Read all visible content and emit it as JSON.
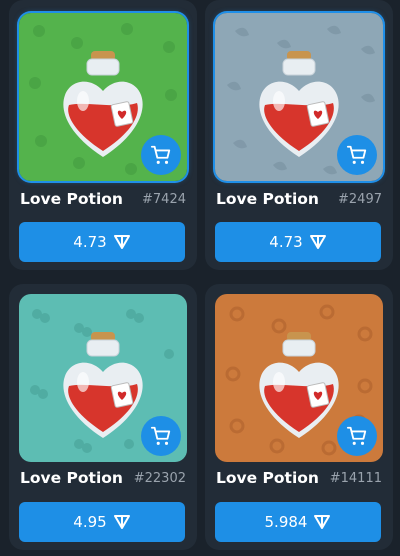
{
  "items": [
    {
      "name": "Love Potion",
      "number": "#7424",
      "price": "4.73",
      "bg": "#54b34c",
      "pattern": "#4aa345",
      "selected": true
    },
    {
      "name": "Love Potion",
      "number": "#2497",
      "price": "4.73",
      "bg": "#8ea7b6",
      "pattern": "#7f98a7",
      "selected": true
    },
    {
      "name": "Love Potion",
      "number": "#22302",
      "price": "4.95",
      "bg": "#5dbdb3",
      "pattern": "#4faaa0",
      "selected": false
    },
    {
      "name": "Love Potion",
      "number": "#14111",
      "price": "5.984",
      "bg": "#cc7a3c",
      "pattern": "#b96a32",
      "selected": false
    }
  ],
  "icons": {
    "cart": "cart-icon",
    "currency": "ton-diamond-icon"
  },
  "colors": {
    "accent": "#1e8fe6",
    "card": "#222c37",
    "page": "#1a222b"
  }
}
